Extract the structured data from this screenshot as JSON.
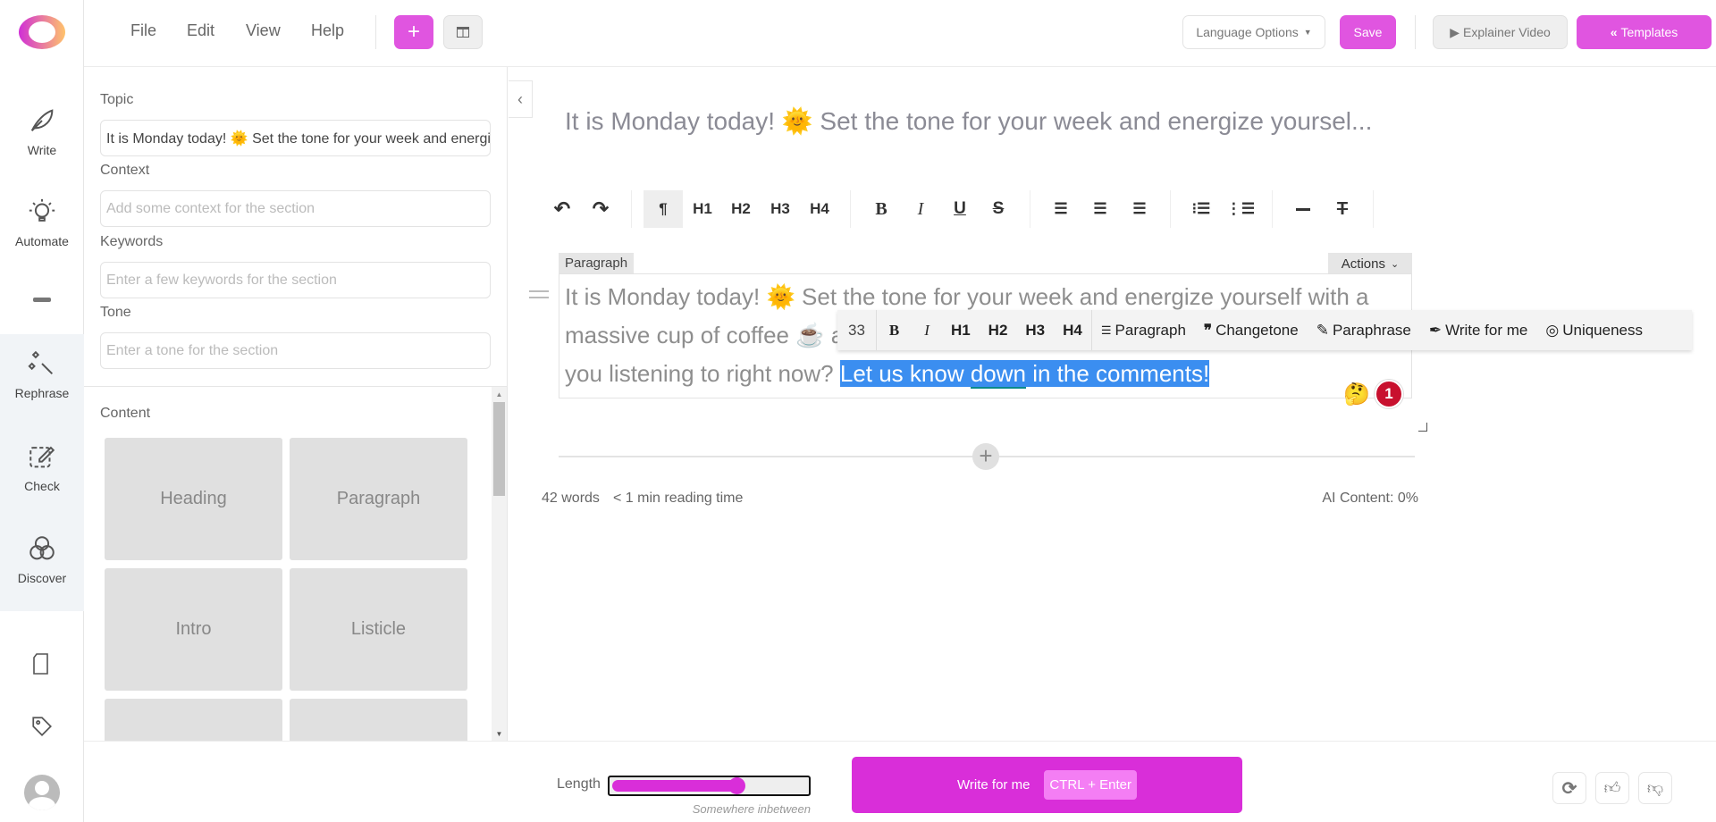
{
  "rail": {
    "items": [
      {
        "label": "Write"
      },
      {
        "label": "Automate"
      },
      {
        "label": "Rephrase"
      },
      {
        "label": "Check"
      },
      {
        "label": "Discover"
      }
    ]
  },
  "header": {
    "menu": [
      "File",
      "Edit",
      "View",
      "Help"
    ],
    "language": "Language Options",
    "save": "Save",
    "explainer": "Explainer Video",
    "templates": "Templates"
  },
  "panel": {
    "topic_label": "Topic",
    "topic_value": "It is Monday today! 🌞 Set the tone for your week and energize yourself with a",
    "context_label": "Context",
    "context_placeholder": "Add some context for the section",
    "keywords_label": "Keywords",
    "keywords_placeholder": "Enter a few keywords for the section",
    "tone_label": "Tone",
    "tone_placeholder": "Enter a tone for the section",
    "content_label": "Content",
    "tiles": [
      "Heading",
      "Paragraph",
      "Intro",
      "Listicle",
      "",
      ""
    ]
  },
  "editor": {
    "title": "It is Monday today! 🌞 Set the tone for your week and energize yoursel...",
    "toolbar": [
      "H1",
      "H2",
      "H3",
      "H4",
      "B",
      "I",
      "U",
      "S"
    ],
    "block_label": "Paragraph",
    "actions": "Actions",
    "line1": "It is Monday today! 🌞 Set the tone for your week and energize yourself with a",
    "line2": "massive cup of coffee ☕ a",
    "line3_pre": "you listening to right now? ",
    "selected_pre": "Let us know ",
    "selected_word": "down",
    "selected_post": " in the comments!",
    "floating": {
      "count": "33",
      "b": "B",
      "i": "I",
      "h1": "H1",
      "h2": "H2",
      "h3": "H3",
      "h4": "H4",
      "paragraph": "Paragraph",
      "changetone": "Changetone",
      "paraphrase": "Paraphrase",
      "write": "Write for me",
      "uniqueness": "Uniqueness"
    },
    "emoji": "🤔",
    "badge": "1",
    "words": "42 words",
    "reading": "< 1 min reading time",
    "ai": "AI Content: 0%"
  },
  "bottom": {
    "length_label": "Length",
    "length_value": 0.65,
    "length_hint": "Somewhere inbetween",
    "write": "Write for me",
    "shortcut": "CTRL + Enter"
  },
  "colors": {
    "accent": "#e055e0",
    "write_button": "#d92ed9",
    "selection": "#3b8ef0",
    "badge": "#c8102e"
  }
}
